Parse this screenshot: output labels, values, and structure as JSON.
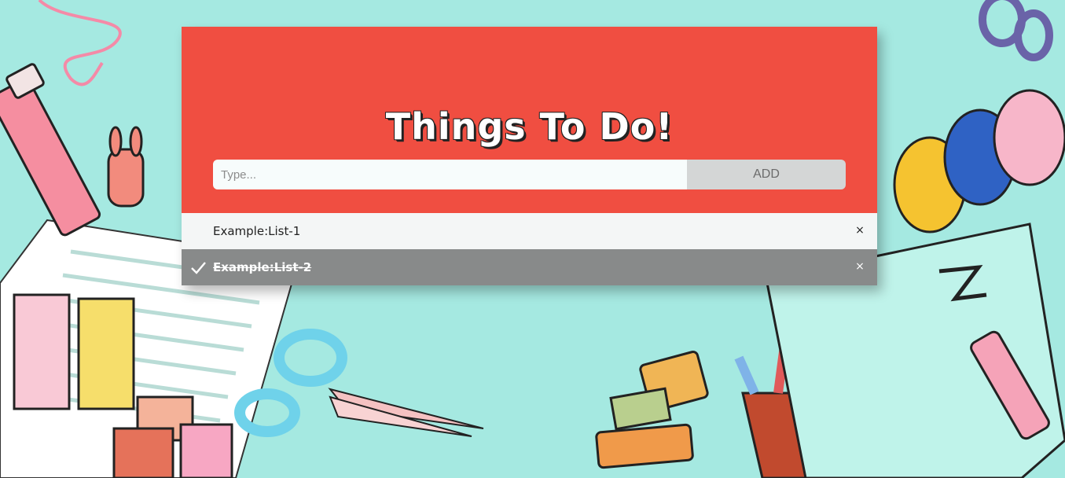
{
  "app": {
    "title": "Things To Do!"
  },
  "input": {
    "placeholder": "Type...",
    "value": ""
  },
  "add_button": {
    "label": "ADD"
  },
  "items": [
    {
      "label": "Example:List-1",
      "done": false,
      "remove_label": "×"
    },
    {
      "label": "Example:List-2",
      "done": true,
      "remove_label": "×"
    }
  ],
  "colors": {
    "background": "#a5e9e1",
    "header": "#f04e41",
    "active_item": "#f4f6f6",
    "done_item": "#888a8a",
    "add_button": "#d4d6d6"
  },
  "icons": {
    "done_marker": "check-icon",
    "remove": "close-icon"
  }
}
